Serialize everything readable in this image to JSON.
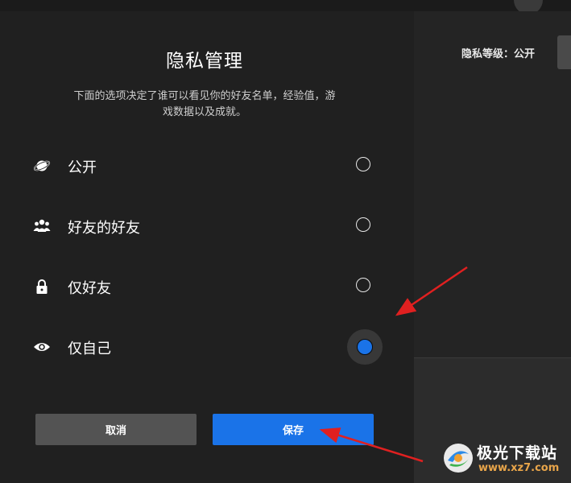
{
  "background": {
    "privacy_level_text": "隐私等级：公开"
  },
  "dialog": {
    "title": "隐私管理",
    "description": "下面的选项决定了谁可以看见你的好友名单，经验值，游戏数据以及成就。",
    "options": [
      {
        "label": "公开",
        "icon": "planet-icon",
        "selected": false
      },
      {
        "label": "好友的好友",
        "icon": "people-icon",
        "selected": false
      },
      {
        "label": "仅好友",
        "icon": "lock-icon",
        "selected": false
      },
      {
        "label": "仅自己",
        "icon": "eye-icon",
        "selected": true
      }
    ],
    "cancel_label": "取消",
    "save_label": "保存"
  },
  "watermark": {
    "name": "极光下载站",
    "url": "www.xz7.com"
  },
  "colors": {
    "accent": "#1a73e8",
    "annotation_arrow": "#e02020",
    "dialog_bg": "#202020"
  }
}
